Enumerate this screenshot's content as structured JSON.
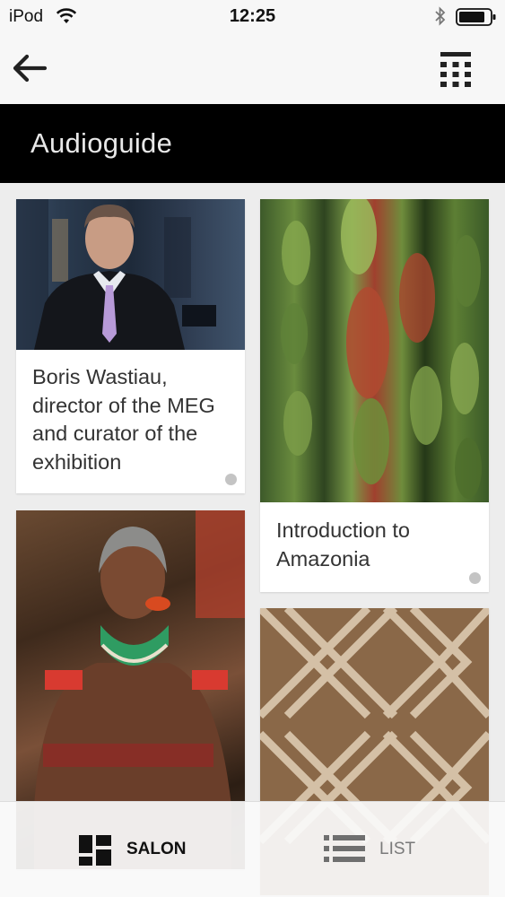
{
  "status_bar": {
    "device": "iPod",
    "time": "12:25",
    "icons": [
      "wifi-icon",
      "bluetooth-icon",
      "battery-icon"
    ]
  },
  "nav": {
    "back_icon": "arrow-left-icon",
    "menu_icon": "grid-menu-icon"
  },
  "header": {
    "title": "Audioguide"
  },
  "cards": [
    {
      "caption": "Boris Wastiau, director of the MEG and curator of the exhibition",
      "image": "portrait of man in suit",
      "has_dot": true
    },
    {
      "caption": "Introduction to Amazonia",
      "image": "green beetle-wing ornament",
      "has_dot": true
    },
    {
      "caption": "",
      "image": "portrait of indigenous elder with lip plate"
    },
    {
      "caption": "",
      "image": "geometric carved pattern"
    }
  ],
  "tabs": [
    {
      "label": "SALON",
      "icon": "mosaic-icon",
      "active": true
    },
    {
      "label": "LIST",
      "icon": "list-icon",
      "active": false
    }
  ],
  "colors": {
    "header_bg": "#000000",
    "page_bg": "#ededed",
    "active_tab": "#111111",
    "inactive_tab": "#7a7a7a"
  }
}
